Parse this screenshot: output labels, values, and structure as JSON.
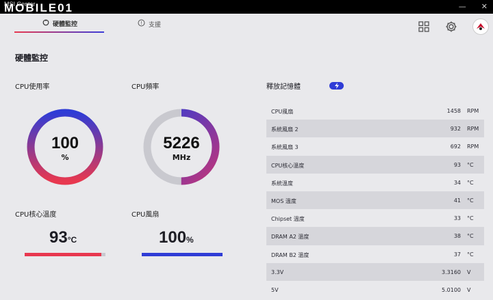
{
  "window": {
    "app_title": "MSI Center",
    "watermark": "MOBILE01"
  },
  "tabs": [
    {
      "label": "硬體監控"
    },
    {
      "label": "支援"
    }
  ],
  "page": {
    "title": "硬體監控"
  },
  "gauges": {
    "cpu_usage": {
      "label": "CPU使用率",
      "value": "100",
      "unit": "%",
      "fraction": 1.0
    },
    "cpu_freq": {
      "label": "CPU頻率",
      "value": "5226",
      "unit": "MHz",
      "fraction": 0.5
    }
  },
  "stats": {
    "cpu_temp": {
      "label": "CPU核心溫度",
      "value": "93",
      "unit": "°C",
      "fraction": 0.95
    },
    "cpu_fan": {
      "label": "CPU風扇",
      "value": "100",
      "unit": "%",
      "fraction": 1.0
    }
  },
  "memory": {
    "label": "釋放記憶體",
    "icon": "lightning-icon"
  },
  "table": [
    {
      "name": "CPU風扇",
      "value": "1458",
      "unit": "RPM"
    },
    {
      "name": "系統風扇 2",
      "value": "932",
      "unit": "RPM"
    },
    {
      "name": "系統風扇 3",
      "value": "692",
      "unit": "RPM"
    },
    {
      "name": "CPU核心溫度",
      "value": "93",
      "unit": "°C"
    },
    {
      "name": "系統溫度",
      "value": "34",
      "unit": "°C"
    },
    {
      "name": "MOS 溫度",
      "value": "41",
      "unit": "°C"
    },
    {
      "name": "Chipset 溫度",
      "value": "33",
      "unit": "°C"
    },
    {
      "name": "DRAM A2 溫度",
      "value": "38",
      "unit": "°C"
    },
    {
      "name": "DRAM B2 溫度",
      "value": "37",
      "unit": "°C"
    },
    {
      "name": "3.3V",
      "value": "3.3160",
      "unit": "V"
    },
    {
      "name": "5V",
      "value": "5.0100",
      "unit": "V"
    }
  ],
  "colors": {
    "red": "#e8384f",
    "blue": "#2f3cd6",
    "track": "#c9c9cf"
  }
}
